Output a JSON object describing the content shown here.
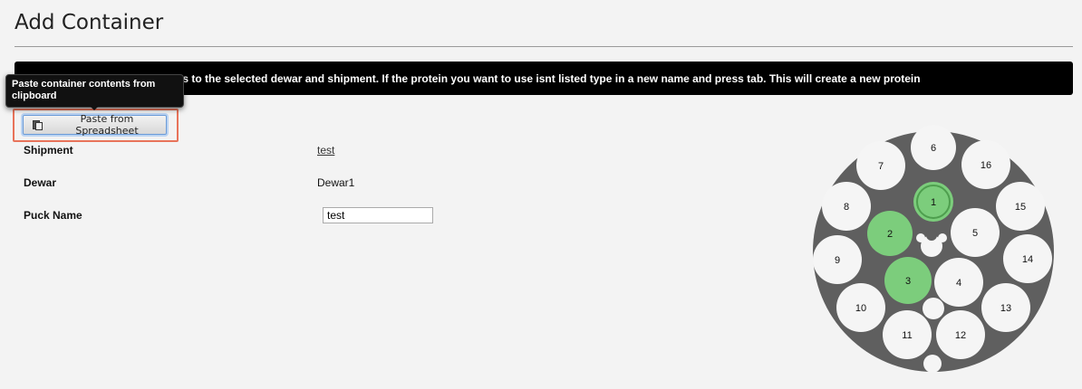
{
  "page": {
    "title": "Add Container"
  },
  "banner": {
    "text": "Use this form to add containers to the selected dewar and shipment. If the protein you want to use isnt listed type in a new name and press tab. This will create a new protein"
  },
  "tooltip": {
    "text": "Paste container contents from clipboard"
  },
  "toolbar": {
    "paste_label": "Paste from Spreadsheet",
    "paste_icon": "clipboard-icon"
  },
  "form": {
    "shipment_label": "Shipment",
    "shipment_value": "test",
    "dewar_label": "Dewar",
    "dewar_value": "Dewar1",
    "puck_name_label": "Puck Name",
    "puck_name_value": "test"
  },
  "puck": {
    "positions": [
      "1",
      "2",
      "3",
      "4",
      "5",
      "6",
      "7",
      "8",
      "9",
      "10",
      "11",
      "12",
      "13",
      "14",
      "15",
      "16"
    ],
    "filled": [
      "1",
      "2",
      "3"
    ],
    "selected": "1",
    "colors": {
      "ring": "#5f5f5f",
      "empty": "#f5f5f5",
      "filled": "#7ccd7c",
      "selected_ring": "#4e9e4e"
    }
  },
  "colors": {
    "highlight": "#e8735a",
    "banner_bg": "#000000"
  }
}
